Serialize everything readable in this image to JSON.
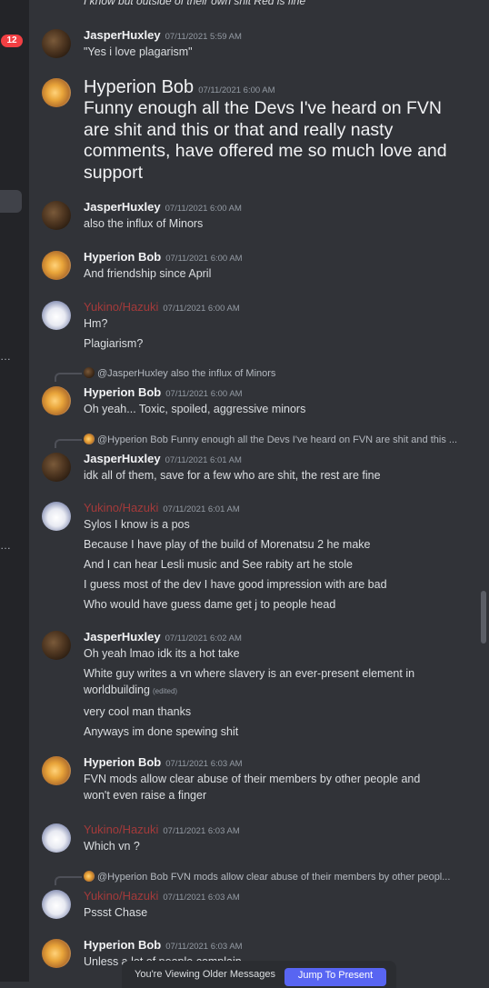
{
  "sidebar": {
    "badge": "12",
    "truncated_1": "…",
    "truncated_2": "…"
  },
  "partial_top": "I know but outside of their own shit Red is fine",
  "messages": [
    {
      "author": "JasperHuxley",
      "timestamp": "07/11/2021 5:59 AM",
      "lines": [
        "\"Yes i love plagarism\""
      ]
    },
    {
      "author": "Hyperion Bob",
      "timestamp": "07/11/2021 6:00 AM",
      "lines": [
        "Funny enough all the Devs I've heard on FVN",
        "are shit and this or that and really nasty",
        "comments, have offered me so much love and",
        "support"
      ]
    },
    {
      "author": "JasperHuxley",
      "timestamp": "07/11/2021 6:00 AM",
      "lines": [
        "also the influx of Minors"
      ]
    },
    {
      "author": "Hyperion Bob",
      "timestamp": "07/11/2021 6:00 AM",
      "lines": [
        "And friendship since April"
      ]
    },
    {
      "author": "Yukino/Hazuki",
      "timestamp": "07/11/2021 6:00 AM",
      "lines": [
        "Hm?",
        "Plagiarism?"
      ]
    },
    {
      "reply_to": "@JasperHuxley",
      "reply_text": "also the influx of Minors",
      "author": "Hyperion Bob",
      "timestamp": "07/11/2021 6:00 AM",
      "lines": [
        "Oh yeah... Toxic, spoiled, aggressive minors"
      ]
    },
    {
      "reply_to": "@Hyperion Bob",
      "reply_text": "Funny enough all the Devs I've heard on FVN are shit and this ...",
      "author": "JasperHuxley",
      "timestamp": "07/11/2021 6:01 AM",
      "lines": [
        "idk all of them, save for a few who are shit, the rest are fine"
      ]
    },
    {
      "author": "Yukino/Hazuki",
      "timestamp": "07/11/2021 6:01 AM",
      "lines": [
        "Sylos I know is a pos",
        "Because I have play of the build of Morenatsu 2 he make",
        "And I can hear Lesli music and See rabity art he stole",
        "I guess most of the dev I have good impression with are bad",
        "Who would have guess dame get j to people head"
      ]
    },
    {
      "author": "JasperHuxley",
      "timestamp": "07/11/2021 6:02 AM",
      "lines": [
        "Oh yeah lmao idk its a hot take",
        "White guy writes a vn where slavery is an ever-present element in",
        "worldbuilding",
        "very cool man thanks",
        "Anyways im done spewing shit"
      ],
      "edited": "(edited)"
    },
    {
      "author": "Hyperion Bob",
      "timestamp": "07/11/2021 6:03 AM",
      "lines": [
        "FVN mods allow clear abuse of their members by other people and",
        "won't even raise a finger"
      ]
    },
    {
      "author": "Yukino/Hazuki",
      "timestamp": "07/11/2021 6:03 AM",
      "lines": [
        "Which vn ?"
      ]
    },
    {
      "reply_to": "@Hyperion Bob",
      "reply_text": "FVN mods allow clear abuse of their members by other peopl...",
      "author": "Yukino/Hazuki",
      "timestamp": "07/11/2021 6:03 AM",
      "lines": [
        "Pssst Chase"
      ]
    },
    {
      "author": "Hyperion Bob",
      "timestamp": "07/11/2021 6:03 AM",
      "lines": [
        "Unless a lot of people complain"
      ]
    }
  ],
  "footer": {
    "older_text": "You're Viewing Older Messages",
    "jump_label": "Jump To Present"
  }
}
